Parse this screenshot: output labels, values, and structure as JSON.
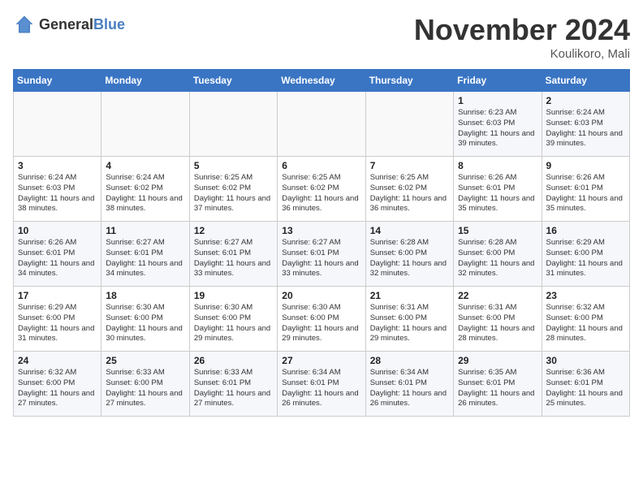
{
  "logo": {
    "general": "General",
    "blue": "Blue"
  },
  "title": "November 2024",
  "location": "Koulikoro, Mali",
  "days_of_week": [
    "Sunday",
    "Monday",
    "Tuesday",
    "Wednesday",
    "Thursday",
    "Friday",
    "Saturday"
  ],
  "weeks": [
    [
      {
        "day": "",
        "info": ""
      },
      {
        "day": "",
        "info": ""
      },
      {
        "day": "",
        "info": ""
      },
      {
        "day": "",
        "info": ""
      },
      {
        "day": "",
        "info": ""
      },
      {
        "day": "1",
        "info": "Sunrise: 6:23 AM\nSunset: 6:03 PM\nDaylight: 11 hours and 39 minutes."
      },
      {
        "day": "2",
        "info": "Sunrise: 6:24 AM\nSunset: 6:03 PM\nDaylight: 11 hours and 39 minutes."
      }
    ],
    [
      {
        "day": "3",
        "info": "Sunrise: 6:24 AM\nSunset: 6:03 PM\nDaylight: 11 hours and 38 minutes."
      },
      {
        "day": "4",
        "info": "Sunrise: 6:24 AM\nSunset: 6:02 PM\nDaylight: 11 hours and 38 minutes."
      },
      {
        "day": "5",
        "info": "Sunrise: 6:25 AM\nSunset: 6:02 PM\nDaylight: 11 hours and 37 minutes."
      },
      {
        "day": "6",
        "info": "Sunrise: 6:25 AM\nSunset: 6:02 PM\nDaylight: 11 hours and 36 minutes."
      },
      {
        "day": "7",
        "info": "Sunrise: 6:25 AM\nSunset: 6:02 PM\nDaylight: 11 hours and 36 minutes."
      },
      {
        "day": "8",
        "info": "Sunrise: 6:26 AM\nSunset: 6:01 PM\nDaylight: 11 hours and 35 minutes."
      },
      {
        "day": "9",
        "info": "Sunrise: 6:26 AM\nSunset: 6:01 PM\nDaylight: 11 hours and 35 minutes."
      }
    ],
    [
      {
        "day": "10",
        "info": "Sunrise: 6:26 AM\nSunset: 6:01 PM\nDaylight: 11 hours and 34 minutes."
      },
      {
        "day": "11",
        "info": "Sunrise: 6:27 AM\nSunset: 6:01 PM\nDaylight: 11 hours and 34 minutes."
      },
      {
        "day": "12",
        "info": "Sunrise: 6:27 AM\nSunset: 6:01 PM\nDaylight: 11 hours and 33 minutes."
      },
      {
        "day": "13",
        "info": "Sunrise: 6:27 AM\nSunset: 6:01 PM\nDaylight: 11 hours and 33 minutes."
      },
      {
        "day": "14",
        "info": "Sunrise: 6:28 AM\nSunset: 6:00 PM\nDaylight: 11 hours and 32 minutes."
      },
      {
        "day": "15",
        "info": "Sunrise: 6:28 AM\nSunset: 6:00 PM\nDaylight: 11 hours and 32 minutes."
      },
      {
        "day": "16",
        "info": "Sunrise: 6:29 AM\nSunset: 6:00 PM\nDaylight: 11 hours and 31 minutes."
      }
    ],
    [
      {
        "day": "17",
        "info": "Sunrise: 6:29 AM\nSunset: 6:00 PM\nDaylight: 11 hours and 31 minutes."
      },
      {
        "day": "18",
        "info": "Sunrise: 6:30 AM\nSunset: 6:00 PM\nDaylight: 11 hours and 30 minutes."
      },
      {
        "day": "19",
        "info": "Sunrise: 6:30 AM\nSunset: 6:00 PM\nDaylight: 11 hours and 29 minutes."
      },
      {
        "day": "20",
        "info": "Sunrise: 6:30 AM\nSunset: 6:00 PM\nDaylight: 11 hours and 29 minutes."
      },
      {
        "day": "21",
        "info": "Sunrise: 6:31 AM\nSunset: 6:00 PM\nDaylight: 11 hours and 29 minutes."
      },
      {
        "day": "22",
        "info": "Sunrise: 6:31 AM\nSunset: 6:00 PM\nDaylight: 11 hours and 28 minutes."
      },
      {
        "day": "23",
        "info": "Sunrise: 6:32 AM\nSunset: 6:00 PM\nDaylight: 11 hours and 28 minutes."
      }
    ],
    [
      {
        "day": "24",
        "info": "Sunrise: 6:32 AM\nSunset: 6:00 PM\nDaylight: 11 hours and 27 minutes."
      },
      {
        "day": "25",
        "info": "Sunrise: 6:33 AM\nSunset: 6:00 PM\nDaylight: 11 hours and 27 minutes."
      },
      {
        "day": "26",
        "info": "Sunrise: 6:33 AM\nSunset: 6:01 PM\nDaylight: 11 hours and 27 minutes."
      },
      {
        "day": "27",
        "info": "Sunrise: 6:34 AM\nSunset: 6:01 PM\nDaylight: 11 hours and 26 minutes."
      },
      {
        "day": "28",
        "info": "Sunrise: 6:34 AM\nSunset: 6:01 PM\nDaylight: 11 hours and 26 minutes."
      },
      {
        "day": "29",
        "info": "Sunrise: 6:35 AM\nSunset: 6:01 PM\nDaylight: 11 hours and 26 minutes."
      },
      {
        "day": "30",
        "info": "Sunrise: 6:36 AM\nSunset: 6:01 PM\nDaylight: 11 hours and 25 minutes."
      }
    ]
  ]
}
